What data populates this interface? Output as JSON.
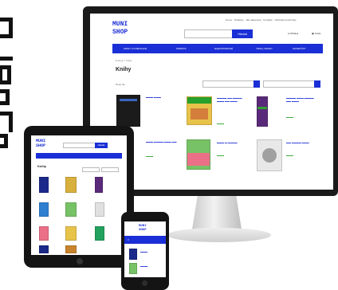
{
  "brand": {
    "logo_top": "MUNI",
    "logo_bottom": "SHOP"
  },
  "monitor": {
    "top_links": [
      "Home",
      "Prodejny",
      "Jak nakupovat",
      "Kontakty",
      "Obchodní podmínky"
    ],
    "search_placeholder": "",
    "search_button": "Hledat",
    "login_label": "Přihlásit",
    "cart_label": "Košík",
    "nav": [
      "KNIHY A PUBLIKACE",
      "SKRIPTA",
      "ELEKTRONICKÉ",
      "TRIKA, MIKINY",
      "SUVENÝRY"
    ],
    "breadcrumb": "E-shop > Knihy",
    "page_title": "Knihy",
    "filter_label": "Řadit dle",
    "sort_label": "Nejnovější",
    "books": [
      {
        "title": "Kniha 1",
        "price": "",
        "color": "#1b1b1b",
        "accent": "#3a66c4"
      },
      {
        "title": "Kniha 2",
        "price": "",
        "color": "#e7c34a",
        "accent": "#27a12c"
      },
      {
        "title": "Kniha 3",
        "price": "",
        "color": "#c9842e",
        "accent": "#2e7d32"
      },
      {
        "title": "Kniha 4",
        "price": "",
        "color": "#5a2a7a",
        "accent": "#2fa22f"
      },
      {
        "title": "Kniha 5",
        "price": "",
        "color": "#2f7fd0",
        "accent": "#f0d53a"
      },
      {
        "title": "Kniha 6",
        "price": "",
        "color": "#ec6f88",
        "accent": "#23a25f"
      },
      {
        "title": "Kniha 7",
        "price": "",
        "color": "#77c266",
        "accent": "#1e6fb6"
      },
      {
        "title": "Kniha 8",
        "price": "",
        "color": "#8f8f8f",
        "accent": "#d0d0d0"
      }
    ]
  },
  "tablet": {
    "search_button": "Hledat",
    "page_title": "Knihy"
  },
  "phone": {
    "menu_label": "Menu"
  }
}
